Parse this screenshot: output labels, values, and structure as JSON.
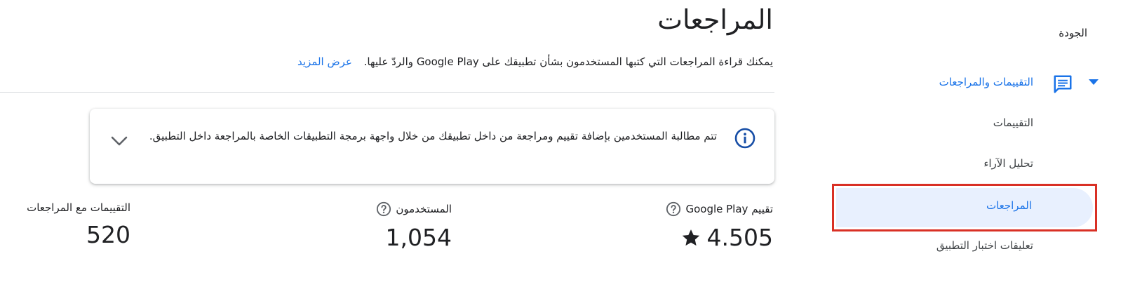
{
  "sidebar": {
    "quality_label": "الجودة",
    "section_label": "التقييمات والمراجعات",
    "items": [
      {
        "label": "التقييمات"
      },
      {
        "label": "تحليل الآراء"
      },
      {
        "label": "المراجعات"
      },
      {
        "label": "تعليقات اختبار التطبيق"
      }
    ]
  },
  "main": {
    "title": "المراجعات",
    "description": "يمكنك قراءة المراجعات التي كتبها المستخدمون بشأن تطبيقك على Google Play والردّ عليها.",
    "learn_more": "عرض المزيد",
    "info_card": {
      "text": "تتم مطالبة المستخدمين بإضافة تقييم ومراجعة من داخل تطبيقك من خلال واجهة برمجة التطبيقات الخاصة بالمراجعة داخل التطبيق."
    },
    "stats": {
      "rating": {
        "label": "تقييم Google Play",
        "value": "4.505"
      },
      "users": {
        "label": "المستخدمون",
        "value": "1,054"
      },
      "with_reviews": {
        "label": "التقييمات مع المراجعات",
        "value": "520"
      }
    }
  },
  "colors": {
    "accent": "#1a73e8",
    "active_bg": "#e8f0fe",
    "highlight_border": "#d93025",
    "info_icon": "#174ea6"
  }
}
